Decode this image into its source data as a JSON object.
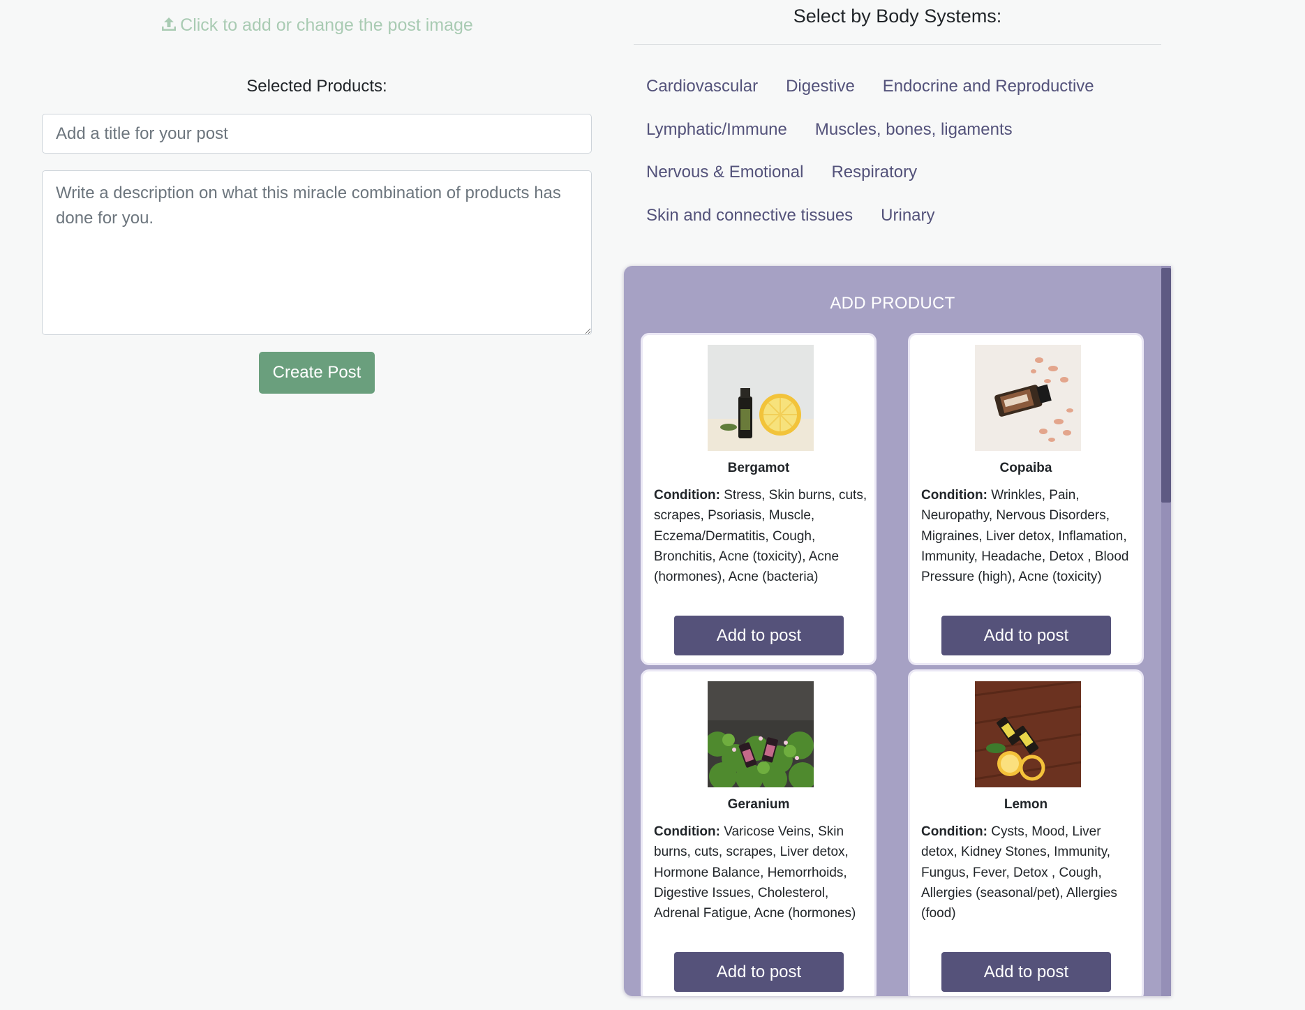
{
  "upload": {
    "label": "Click to add or change the post image",
    "icon": "upload-icon"
  },
  "selected_products_label": "Selected Products:",
  "form": {
    "title_placeholder": "Add a title for your post",
    "description_placeholder": "Write a description on what this miracle combination of products has done for you.",
    "create_button": "Create Post"
  },
  "body_systems": {
    "title": "Select by Body Systems:",
    "rows": [
      [
        "Cardiovascular",
        "Digestive",
        "Endocrine and Reproductive"
      ],
      [
        "Lymphatic/Immune",
        "Muscles, bones, ligaments"
      ],
      [
        "Nervous & Emotional",
        "Respiratory"
      ],
      [
        "Skin and connective tissues",
        "Urinary"
      ]
    ]
  },
  "panel": {
    "title": "ADD PRODUCT",
    "condition_label": "Condition:",
    "button_label": "Add to post",
    "products": [
      {
        "name": "Bergamot",
        "condition": "Stress, Skin burns, cuts, scrapes, Psoriasis, Muscle, Eczema/Dermatitis, Cough, Bronchitis, Acne (toxicity), Acne (hormones), Acne (bacteria)",
        "image": "bergamot-bottle-with-lemon"
      },
      {
        "name": "Copaiba",
        "condition": "Wrinkles, Pain, Neuropathy, Nervous Disorders, Migraines, Liver detox, Inflamation, Immunity, Headache, Detox , Blood Pressure (high), Acne (toxicity)",
        "image": "copaiba-bottle-on-sand"
      },
      {
        "name": "Geranium",
        "condition": "Varicose Veins, Skin burns, cuts, scrapes, Liver detox, Hormone Balance, Hemorrhoids, Digestive Issues, Cholesterol, Adrenal Fatigue, Acne (hormones)",
        "image": "geranium-bottles-in-leaves"
      },
      {
        "name": "Lemon",
        "condition": "Cysts, Mood, Liver detox, Kidney Stones, Immunity, Fungus, Fever, Detox , Cough, Allergies (seasonal/pet), Allergies (food)",
        "image": "lemon-bottles-on-wood"
      }
    ]
  },
  "colors": {
    "page_bg": "#f7f8f8",
    "upload_text": "#a9cbb3",
    "create_button": "#6a9f7d",
    "body_system_link": "#53527a",
    "panel_bg": "#a6a1c4",
    "add_button": "#55527a"
  }
}
